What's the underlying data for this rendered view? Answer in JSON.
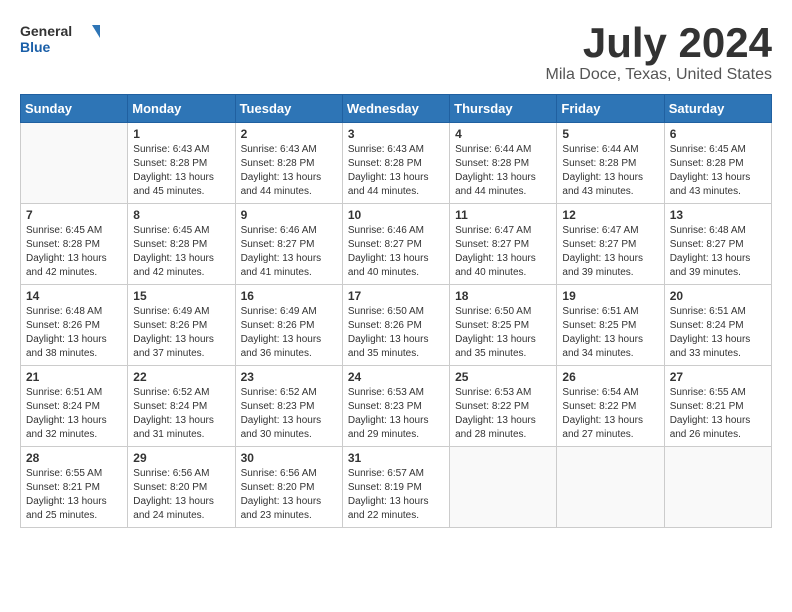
{
  "logo": {
    "text_general": "General",
    "text_blue": "Blue"
  },
  "title": "July 2024",
  "subtitle": "Mila Doce, Texas, United States",
  "days_of_week": [
    "Sunday",
    "Monday",
    "Tuesday",
    "Wednesday",
    "Thursday",
    "Friday",
    "Saturday"
  ],
  "weeks": [
    [
      {
        "day": "",
        "sunrise": "",
        "sunset": "",
        "daylight": ""
      },
      {
        "day": "1",
        "sunrise": "Sunrise: 6:43 AM",
        "sunset": "Sunset: 8:28 PM",
        "daylight": "Daylight: 13 hours and 45 minutes."
      },
      {
        "day": "2",
        "sunrise": "Sunrise: 6:43 AM",
        "sunset": "Sunset: 8:28 PM",
        "daylight": "Daylight: 13 hours and 44 minutes."
      },
      {
        "day": "3",
        "sunrise": "Sunrise: 6:43 AM",
        "sunset": "Sunset: 8:28 PM",
        "daylight": "Daylight: 13 hours and 44 minutes."
      },
      {
        "day": "4",
        "sunrise": "Sunrise: 6:44 AM",
        "sunset": "Sunset: 8:28 PM",
        "daylight": "Daylight: 13 hours and 44 minutes."
      },
      {
        "day": "5",
        "sunrise": "Sunrise: 6:44 AM",
        "sunset": "Sunset: 8:28 PM",
        "daylight": "Daylight: 13 hours and 43 minutes."
      },
      {
        "day": "6",
        "sunrise": "Sunrise: 6:45 AM",
        "sunset": "Sunset: 8:28 PM",
        "daylight": "Daylight: 13 hours and 43 minutes."
      }
    ],
    [
      {
        "day": "7",
        "sunrise": "Sunrise: 6:45 AM",
        "sunset": "Sunset: 8:28 PM",
        "daylight": "Daylight: 13 hours and 42 minutes."
      },
      {
        "day": "8",
        "sunrise": "Sunrise: 6:45 AM",
        "sunset": "Sunset: 8:28 PM",
        "daylight": "Daylight: 13 hours and 42 minutes."
      },
      {
        "day": "9",
        "sunrise": "Sunrise: 6:46 AM",
        "sunset": "Sunset: 8:27 PM",
        "daylight": "Daylight: 13 hours and 41 minutes."
      },
      {
        "day": "10",
        "sunrise": "Sunrise: 6:46 AM",
        "sunset": "Sunset: 8:27 PM",
        "daylight": "Daylight: 13 hours and 40 minutes."
      },
      {
        "day": "11",
        "sunrise": "Sunrise: 6:47 AM",
        "sunset": "Sunset: 8:27 PM",
        "daylight": "Daylight: 13 hours and 40 minutes."
      },
      {
        "day": "12",
        "sunrise": "Sunrise: 6:47 AM",
        "sunset": "Sunset: 8:27 PM",
        "daylight": "Daylight: 13 hours and 39 minutes."
      },
      {
        "day": "13",
        "sunrise": "Sunrise: 6:48 AM",
        "sunset": "Sunset: 8:27 PM",
        "daylight": "Daylight: 13 hours and 39 minutes."
      }
    ],
    [
      {
        "day": "14",
        "sunrise": "Sunrise: 6:48 AM",
        "sunset": "Sunset: 8:26 PM",
        "daylight": "Daylight: 13 hours and 38 minutes."
      },
      {
        "day": "15",
        "sunrise": "Sunrise: 6:49 AM",
        "sunset": "Sunset: 8:26 PM",
        "daylight": "Daylight: 13 hours and 37 minutes."
      },
      {
        "day": "16",
        "sunrise": "Sunrise: 6:49 AM",
        "sunset": "Sunset: 8:26 PM",
        "daylight": "Daylight: 13 hours and 36 minutes."
      },
      {
        "day": "17",
        "sunrise": "Sunrise: 6:50 AM",
        "sunset": "Sunset: 8:26 PM",
        "daylight": "Daylight: 13 hours and 35 minutes."
      },
      {
        "day": "18",
        "sunrise": "Sunrise: 6:50 AM",
        "sunset": "Sunset: 8:25 PM",
        "daylight": "Daylight: 13 hours and 35 minutes."
      },
      {
        "day": "19",
        "sunrise": "Sunrise: 6:51 AM",
        "sunset": "Sunset: 8:25 PM",
        "daylight": "Daylight: 13 hours and 34 minutes."
      },
      {
        "day": "20",
        "sunrise": "Sunrise: 6:51 AM",
        "sunset": "Sunset: 8:24 PM",
        "daylight": "Daylight: 13 hours and 33 minutes."
      }
    ],
    [
      {
        "day": "21",
        "sunrise": "Sunrise: 6:51 AM",
        "sunset": "Sunset: 8:24 PM",
        "daylight": "Daylight: 13 hours and 32 minutes."
      },
      {
        "day": "22",
        "sunrise": "Sunrise: 6:52 AM",
        "sunset": "Sunset: 8:24 PM",
        "daylight": "Daylight: 13 hours and 31 minutes."
      },
      {
        "day": "23",
        "sunrise": "Sunrise: 6:52 AM",
        "sunset": "Sunset: 8:23 PM",
        "daylight": "Daylight: 13 hours and 30 minutes."
      },
      {
        "day": "24",
        "sunrise": "Sunrise: 6:53 AM",
        "sunset": "Sunset: 8:23 PM",
        "daylight": "Daylight: 13 hours and 29 minutes."
      },
      {
        "day": "25",
        "sunrise": "Sunrise: 6:53 AM",
        "sunset": "Sunset: 8:22 PM",
        "daylight": "Daylight: 13 hours and 28 minutes."
      },
      {
        "day": "26",
        "sunrise": "Sunrise: 6:54 AM",
        "sunset": "Sunset: 8:22 PM",
        "daylight": "Daylight: 13 hours and 27 minutes."
      },
      {
        "day": "27",
        "sunrise": "Sunrise: 6:55 AM",
        "sunset": "Sunset: 8:21 PM",
        "daylight": "Daylight: 13 hours and 26 minutes."
      }
    ],
    [
      {
        "day": "28",
        "sunrise": "Sunrise: 6:55 AM",
        "sunset": "Sunset: 8:21 PM",
        "daylight": "Daylight: 13 hours and 25 minutes."
      },
      {
        "day": "29",
        "sunrise": "Sunrise: 6:56 AM",
        "sunset": "Sunset: 8:20 PM",
        "daylight": "Daylight: 13 hours and 24 minutes."
      },
      {
        "day": "30",
        "sunrise": "Sunrise: 6:56 AM",
        "sunset": "Sunset: 8:20 PM",
        "daylight": "Daylight: 13 hours and 23 minutes."
      },
      {
        "day": "31",
        "sunrise": "Sunrise: 6:57 AM",
        "sunset": "Sunset: 8:19 PM",
        "daylight": "Daylight: 13 hours and 22 minutes."
      },
      {
        "day": "",
        "sunrise": "",
        "sunset": "",
        "daylight": ""
      },
      {
        "day": "",
        "sunrise": "",
        "sunset": "",
        "daylight": ""
      },
      {
        "day": "",
        "sunrise": "",
        "sunset": "",
        "daylight": ""
      }
    ]
  ]
}
